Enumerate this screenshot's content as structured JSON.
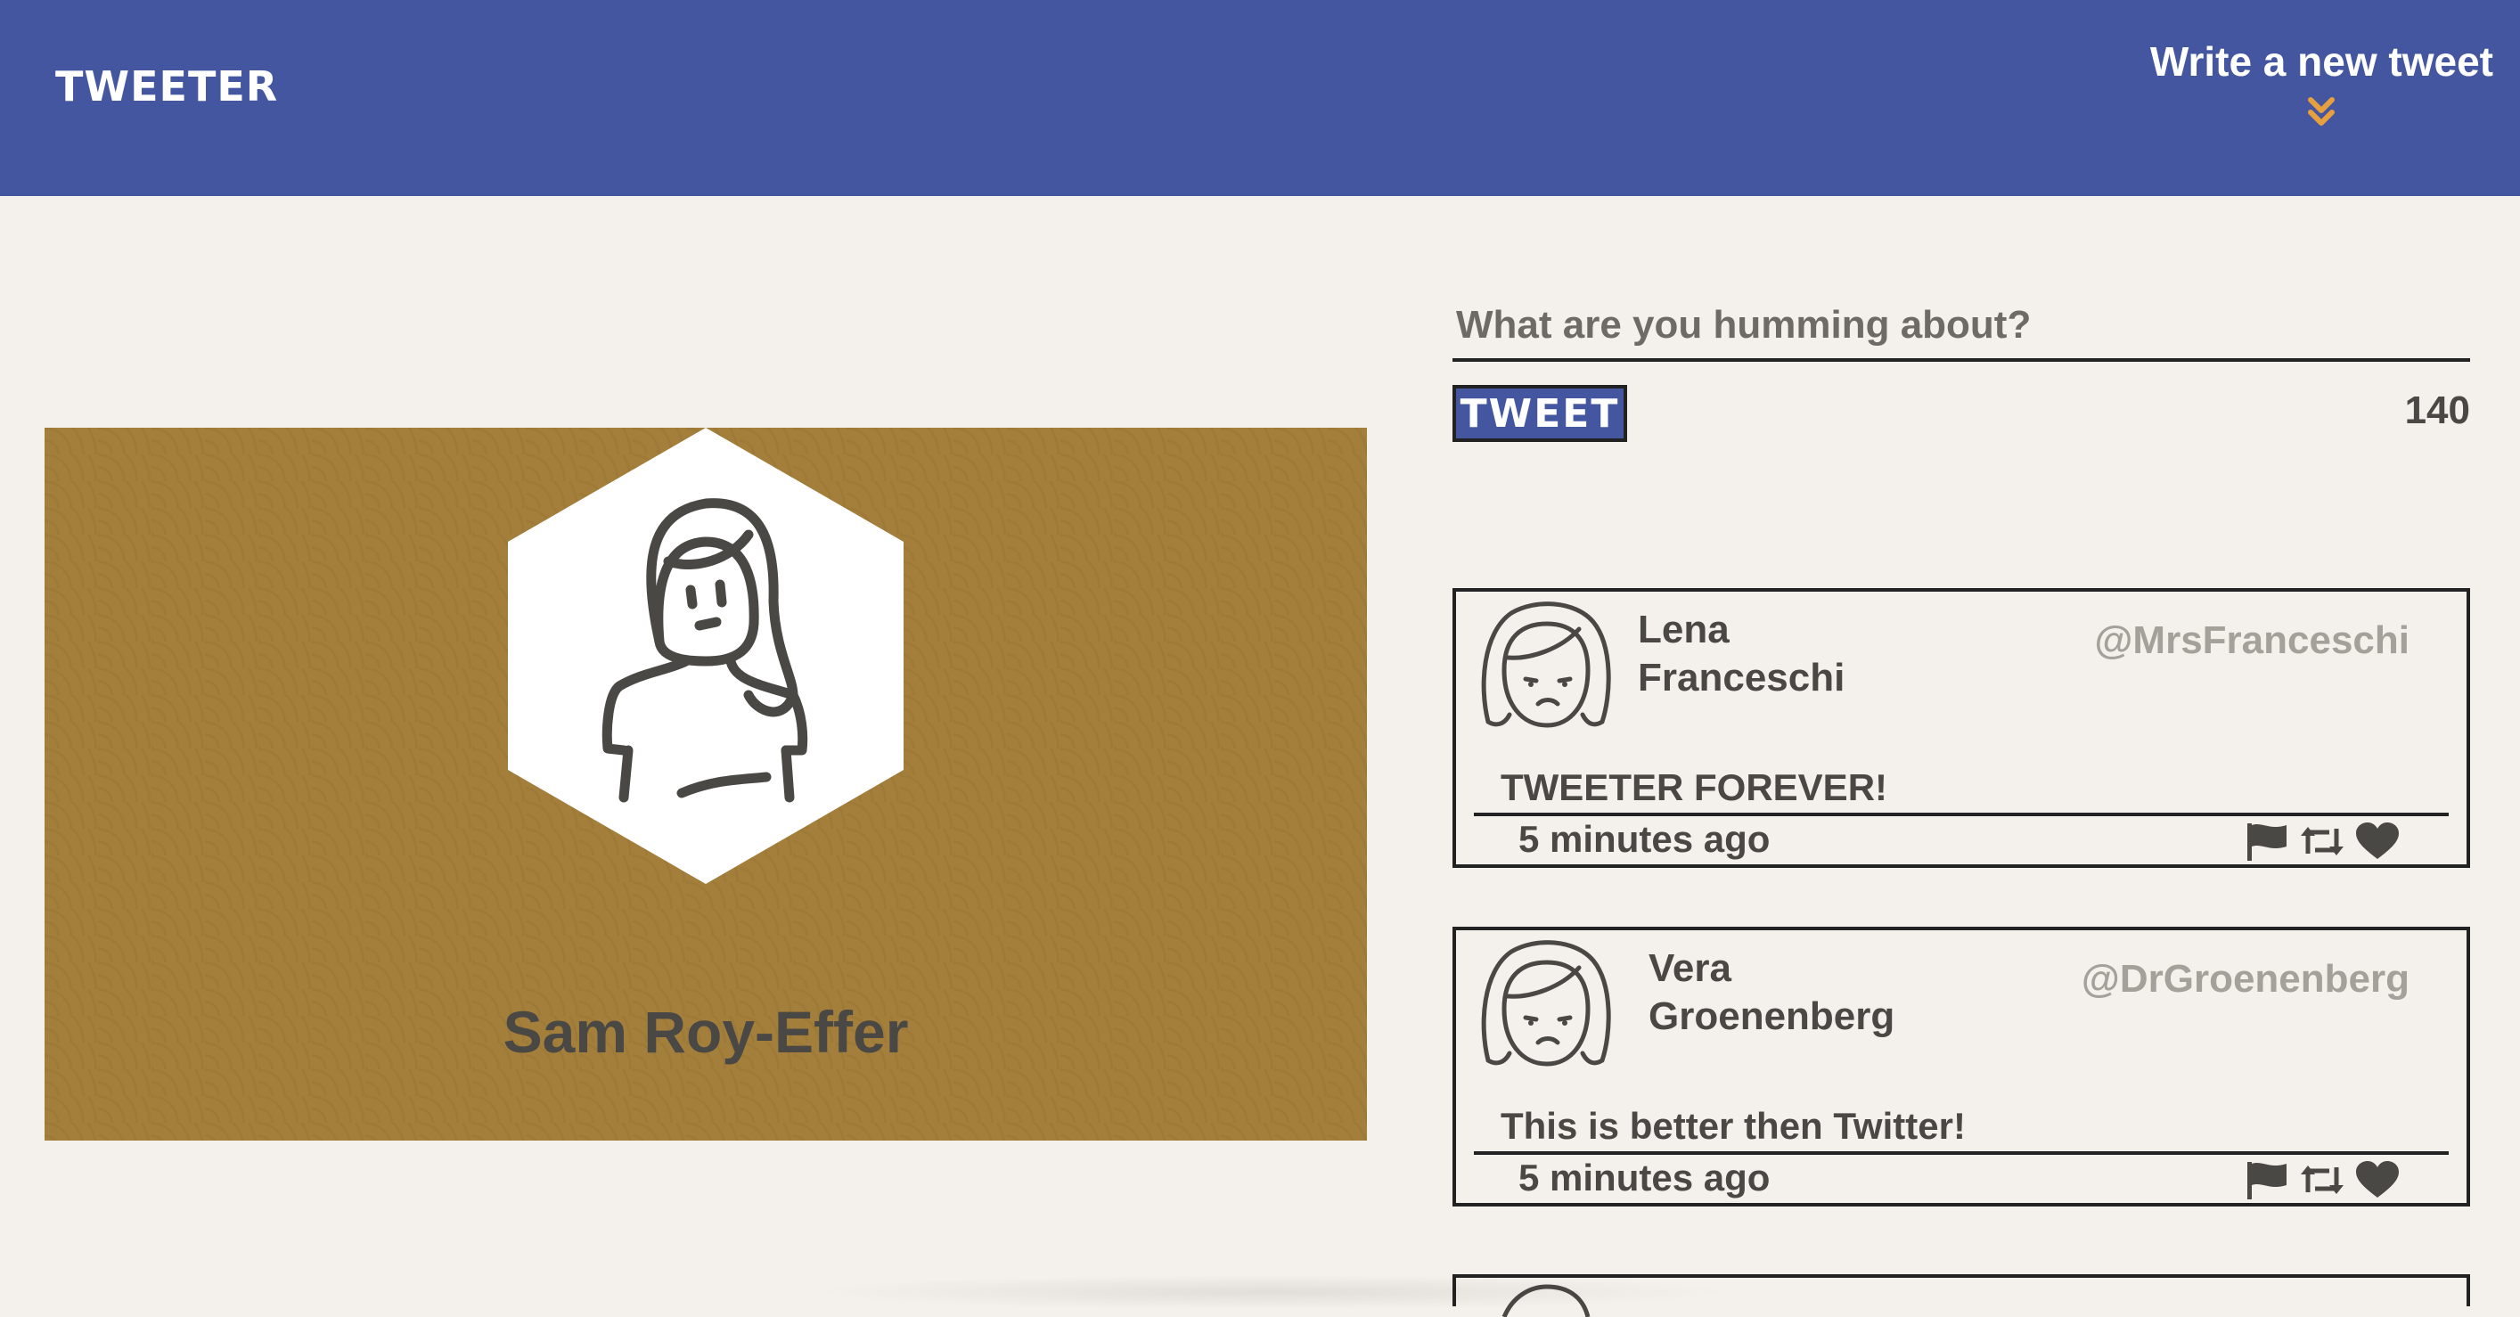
{
  "nav": {
    "brand": "TWEETER",
    "compose_toggle": "Write a new tweet",
    "chevron_icon": "double-chevron-down-icon",
    "colors": {
      "nav_bg": "#4556a0",
      "chevron": "#e6a03e"
    }
  },
  "profile": {
    "name": "Sam Roy-Effer",
    "avatar_icon": "user-avatar-icon",
    "banner_color": "#a47e3b"
  },
  "compose": {
    "placeholder": "What are you humming about?",
    "button_label": "TWEET",
    "char_count": "140"
  },
  "tweets": [
    {
      "name_first": "Lena",
      "name_last": "Franceschi",
      "handle": "@MrsFranceschi",
      "text": "TWEETER FOREVER!",
      "time": "5 minutes ago",
      "actions": [
        "flag-icon",
        "retweet-icon",
        "heart-icon"
      ]
    },
    {
      "name_first": "Vera",
      "name_last": "Groenenberg",
      "handle": "@DrGroenenberg",
      "text": "This is better then Twitter!",
      "time": "5 minutes ago",
      "actions": [
        "flag-icon",
        "retweet-icon",
        "heart-icon"
      ]
    }
  ]
}
